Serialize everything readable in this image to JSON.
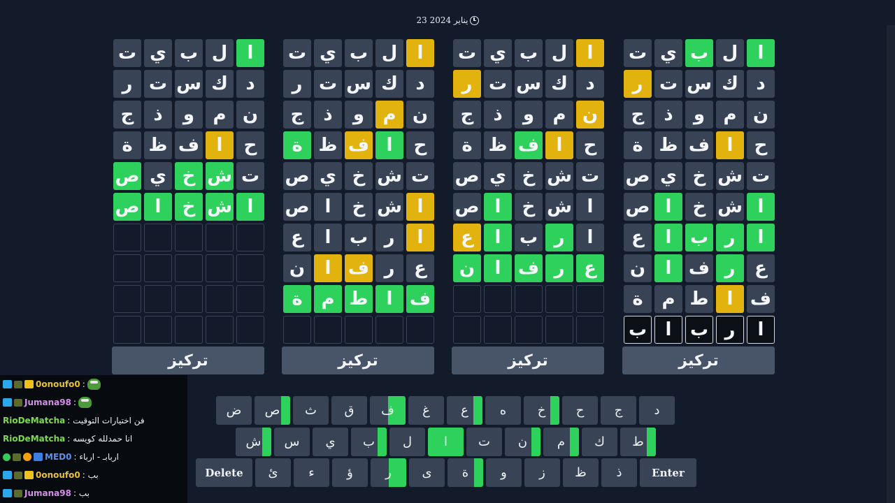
{
  "date": "23 يناير 2024",
  "focus_label": "تركيز",
  "boards": [
    {
      "name": "board-1",
      "rows": [
        [
          [
            "ا",
            "g"
          ],
          [
            "ل",
            ""
          ],
          [
            "ب",
            ""
          ],
          [
            "ي",
            ""
          ],
          [
            "ت",
            ""
          ]
        ],
        [
          [
            "د",
            ""
          ],
          [
            "ك",
            ""
          ],
          [
            "س",
            ""
          ],
          [
            "ت",
            ""
          ],
          [
            "ر",
            ""
          ]
        ],
        [
          [
            "ن",
            ""
          ],
          [
            "م",
            ""
          ],
          [
            "و",
            ""
          ],
          [
            "ذ",
            ""
          ],
          [
            "ج",
            ""
          ]
        ],
        [
          [
            "ح",
            ""
          ],
          [
            "ا",
            "y"
          ],
          [
            "ف",
            ""
          ],
          [
            "ظ",
            ""
          ],
          [
            "ة",
            ""
          ]
        ],
        [
          [
            "ت",
            ""
          ],
          [
            "ش",
            "g"
          ],
          [
            "خ",
            "g"
          ],
          [
            "ي",
            ""
          ],
          [
            "ص",
            "g"
          ]
        ],
        [
          [
            "ا",
            "g"
          ],
          [
            "ش",
            "g"
          ],
          [
            "خ",
            "g"
          ],
          [
            "ا",
            "g"
          ],
          [
            "ص",
            "g"
          ]
        ],
        [
          [
            "",
            "e"
          ],
          [
            "",
            "e"
          ],
          [
            "",
            "e"
          ],
          [
            "",
            "e"
          ],
          [
            "",
            "e"
          ]
        ],
        [
          [
            "",
            "e"
          ],
          [
            "",
            "e"
          ],
          [
            "",
            "e"
          ],
          [
            "",
            "e"
          ],
          [
            "",
            "e"
          ]
        ],
        [
          [
            "",
            "e"
          ],
          [
            "",
            "e"
          ],
          [
            "",
            "e"
          ],
          [
            "",
            "e"
          ],
          [
            "",
            "e"
          ]
        ],
        [
          [
            "",
            "e"
          ],
          [
            "",
            "e"
          ],
          [
            "",
            "e"
          ],
          [
            "",
            "e"
          ],
          [
            "",
            "e"
          ]
        ]
      ]
    },
    {
      "name": "board-2",
      "rows": [
        [
          [
            "ا",
            "y"
          ],
          [
            "ل",
            ""
          ],
          [
            "ب",
            ""
          ],
          [
            "ي",
            ""
          ],
          [
            "ت",
            ""
          ]
        ],
        [
          [
            "د",
            ""
          ],
          [
            "ك",
            ""
          ],
          [
            "س",
            ""
          ],
          [
            "ت",
            ""
          ],
          [
            "ر",
            ""
          ]
        ],
        [
          [
            "ن",
            ""
          ],
          [
            "م",
            "y"
          ],
          [
            "و",
            ""
          ],
          [
            "ذ",
            ""
          ],
          [
            "ج",
            ""
          ]
        ],
        [
          [
            "ح",
            ""
          ],
          [
            "ا",
            "g"
          ],
          [
            "ف",
            "y"
          ],
          [
            "ظ",
            ""
          ],
          [
            "ة",
            "g"
          ]
        ],
        [
          [
            "ت",
            ""
          ],
          [
            "ش",
            ""
          ],
          [
            "خ",
            ""
          ],
          [
            "ي",
            ""
          ],
          [
            "ص",
            ""
          ]
        ],
        [
          [
            "ا",
            "y"
          ],
          [
            "ش",
            ""
          ],
          [
            "خ",
            ""
          ],
          [
            "ا",
            ""
          ],
          [
            "ص",
            ""
          ]
        ],
        [
          [
            "ا",
            "y"
          ],
          [
            "ر",
            ""
          ],
          [
            "ب",
            ""
          ],
          [
            "ا",
            ""
          ],
          [
            "ع",
            ""
          ]
        ],
        [
          [
            "ع",
            ""
          ],
          [
            "ر",
            ""
          ],
          [
            "ف",
            "y"
          ],
          [
            "ا",
            "y"
          ],
          [
            "ن",
            ""
          ]
        ],
        [
          [
            "ف",
            "g"
          ],
          [
            "ا",
            "g"
          ],
          [
            "ط",
            "g"
          ],
          [
            "م",
            "g"
          ],
          [
            "ة",
            "g"
          ]
        ],
        [
          [
            "",
            "e"
          ],
          [
            "",
            "e"
          ],
          [
            "",
            "e"
          ],
          [
            "",
            "e"
          ],
          [
            "",
            "e"
          ]
        ]
      ]
    },
    {
      "name": "board-3",
      "rows": [
        [
          [
            "ا",
            "y"
          ],
          [
            "ل",
            ""
          ],
          [
            "ب",
            ""
          ],
          [
            "ي",
            ""
          ],
          [
            "ت",
            ""
          ]
        ],
        [
          [
            "د",
            ""
          ],
          [
            "ك",
            ""
          ],
          [
            "س",
            ""
          ],
          [
            "ت",
            ""
          ],
          [
            "ر",
            "y"
          ]
        ],
        [
          [
            "ن",
            "y"
          ],
          [
            "م",
            ""
          ],
          [
            "و",
            ""
          ],
          [
            "ذ",
            ""
          ],
          [
            "ج",
            ""
          ]
        ],
        [
          [
            "ح",
            ""
          ],
          [
            "ا",
            "y"
          ],
          [
            "ف",
            "g"
          ],
          [
            "ظ",
            ""
          ],
          [
            "ة",
            ""
          ]
        ],
        [
          [
            "ت",
            ""
          ],
          [
            "ش",
            ""
          ],
          [
            "خ",
            ""
          ],
          [
            "ي",
            ""
          ],
          [
            "ص",
            ""
          ]
        ],
        [
          [
            "ا",
            ""
          ],
          [
            "ش",
            ""
          ],
          [
            "خ",
            ""
          ],
          [
            "ا",
            "g"
          ],
          [
            "ص",
            ""
          ]
        ],
        [
          [
            "ا",
            ""
          ],
          [
            "ر",
            "g"
          ],
          [
            "ب",
            ""
          ],
          [
            "ا",
            "g"
          ],
          [
            "ع",
            "y"
          ]
        ],
        [
          [
            "ع",
            "g"
          ],
          [
            "ر",
            "g"
          ],
          [
            "ف",
            "g"
          ],
          [
            "ا",
            "g"
          ],
          [
            "ن",
            "g"
          ]
        ],
        [
          [
            "",
            "e"
          ],
          [
            "",
            "e"
          ],
          [
            "",
            "e"
          ],
          [
            "",
            "e"
          ],
          [
            "",
            "e"
          ]
        ],
        [
          [
            "",
            "e"
          ],
          [
            "",
            "e"
          ],
          [
            "",
            "e"
          ],
          [
            "",
            "e"
          ],
          [
            "",
            "e"
          ]
        ]
      ]
    },
    {
      "name": "board-4",
      "rows": [
        [
          [
            "ا",
            "g"
          ],
          [
            "ل",
            ""
          ],
          [
            "ب",
            "g"
          ],
          [
            "ي",
            ""
          ],
          [
            "ت",
            ""
          ]
        ],
        [
          [
            "د",
            ""
          ],
          [
            "ك",
            ""
          ],
          [
            "س",
            ""
          ],
          [
            "ت",
            ""
          ],
          [
            "ر",
            "y"
          ]
        ],
        [
          [
            "ن",
            ""
          ],
          [
            "م",
            ""
          ],
          [
            "و",
            ""
          ],
          [
            "ذ",
            ""
          ],
          [
            "ج",
            ""
          ]
        ],
        [
          [
            "ح",
            ""
          ],
          [
            "ا",
            "y"
          ],
          [
            "ف",
            ""
          ],
          [
            "ظ",
            ""
          ],
          [
            "ة",
            ""
          ]
        ],
        [
          [
            "ت",
            ""
          ],
          [
            "ش",
            ""
          ],
          [
            "خ",
            ""
          ],
          [
            "ي",
            ""
          ],
          [
            "ص",
            ""
          ]
        ],
        [
          [
            "ا",
            "g"
          ],
          [
            "ش",
            ""
          ],
          [
            "خ",
            ""
          ],
          [
            "ا",
            "g"
          ],
          [
            "ص",
            ""
          ]
        ],
        [
          [
            "ا",
            "g"
          ],
          [
            "ر",
            "g"
          ],
          [
            "ب",
            "g"
          ],
          [
            "ا",
            "g"
          ],
          [
            "ع",
            ""
          ]
        ],
        [
          [
            "ع",
            ""
          ],
          [
            "ر",
            "g"
          ],
          [
            "ف",
            ""
          ],
          [
            "ا",
            "g"
          ],
          [
            "ن",
            ""
          ]
        ],
        [
          [
            "ف",
            ""
          ],
          [
            "ا",
            "y"
          ],
          [
            "ط",
            ""
          ],
          [
            "م",
            ""
          ],
          [
            "ة",
            ""
          ]
        ],
        [
          [
            "ا",
            "w"
          ],
          [
            "ر",
            "w"
          ],
          [
            "ب",
            "w"
          ],
          [
            "ا",
            "w"
          ],
          [
            "ب",
            "w"
          ]
        ]
      ]
    }
  ],
  "keyboard": {
    "rows": [
      [
        {
          "label": "ض",
          "green": 0
        },
        {
          "label": "ص",
          "green": 0.25
        },
        {
          "label": "ث",
          "green": 0
        },
        {
          "label": "ق",
          "green": 0
        },
        {
          "label": "ف",
          "green": 0.5
        },
        {
          "label": "غ",
          "green": 0
        },
        {
          "label": "ع",
          "green": 0.25
        },
        {
          "label": "ه",
          "green": 0
        },
        {
          "label": "خ",
          "green": 0.25
        },
        {
          "label": "ح",
          "green": 0
        },
        {
          "label": "ج",
          "green": 0
        },
        {
          "label": "د",
          "green": 0
        }
      ],
      [
        {
          "label": "ش",
          "green": 0.25
        },
        {
          "label": "س",
          "green": 0
        },
        {
          "label": "ي",
          "green": 0
        },
        {
          "label": "ب",
          "green": 0.25
        },
        {
          "label": "ل",
          "green": 0
        },
        {
          "label": "ا",
          "green": 1
        },
        {
          "label": "ت",
          "green": 0
        },
        {
          "label": "ن",
          "green": 0.25
        },
        {
          "label": "م",
          "green": 0.25
        },
        {
          "label": "ك",
          "green": 0
        },
        {
          "label": "ط",
          "green": 0.25
        }
      ],
      [
        {
          "label": "Delete",
          "green": 0,
          "wide": true
        },
        {
          "label": "ئ",
          "green": 0
        },
        {
          "label": "ء",
          "green": 0
        },
        {
          "label": "ؤ",
          "green": 0
        },
        {
          "label": "ر",
          "green": 0.5
        },
        {
          "label": "ى",
          "green": 0
        },
        {
          "label": "ة",
          "green": 0.25
        },
        {
          "label": "و",
          "green": 0
        },
        {
          "label": "ز",
          "green": 0
        },
        {
          "label": "ظ",
          "green": 0
        },
        {
          "label": "ذ",
          "green": 0
        },
        {
          "label": "Enter",
          "green": 0,
          "wide": true
        }
      ]
    ]
  },
  "chat": {
    "messages": [
      {
        "badges": [
          "blue",
          "tag",
          "gold"
        ],
        "user": "0onoufo0",
        "user_color": "#e8c233",
        "text": " : ",
        "emote": "frog"
      },
      {
        "badges": [
          "blue",
          "tag"
        ],
        "user": "Jumana98",
        "user_color": "#d58de8",
        "text": " : ",
        "emote": "frog"
      },
      {
        "badges": [],
        "user": "RioDeMatcha",
        "user_color": "#7cd94a",
        "text": " : فن اختيارات التوقيت",
        "emote": ""
      },
      {
        "badges": [],
        "user": "RioDeMatcha",
        "user_color": "#7cd94a",
        "text": " : انا حمدلله كويسه",
        "emote": ""
      },
      {
        "badges": [
          "green",
          "tag",
          "orange",
          "stack"
        ],
        "user": "MED0",
        "user_color": "#5b8fe8",
        "text": " : اربابـ - ارباء",
        "emote": ""
      },
      {
        "badges": [
          "blue",
          "tag",
          "gold"
        ],
        "user": "0onoufo0",
        "user_color": "#e8c233",
        "text": " : بب",
        "emote": ""
      },
      {
        "badges": [
          "blue",
          "tag"
        ],
        "user": "Jumana98",
        "user_color": "#d58de8",
        "text": " : بب",
        "emote": ""
      }
    ]
  },
  "colors": {
    "background": "#131b2b",
    "tile": "#384456",
    "correct": "#2fd15d",
    "present": "#e2b20f",
    "focus_button": "#485468"
  }
}
